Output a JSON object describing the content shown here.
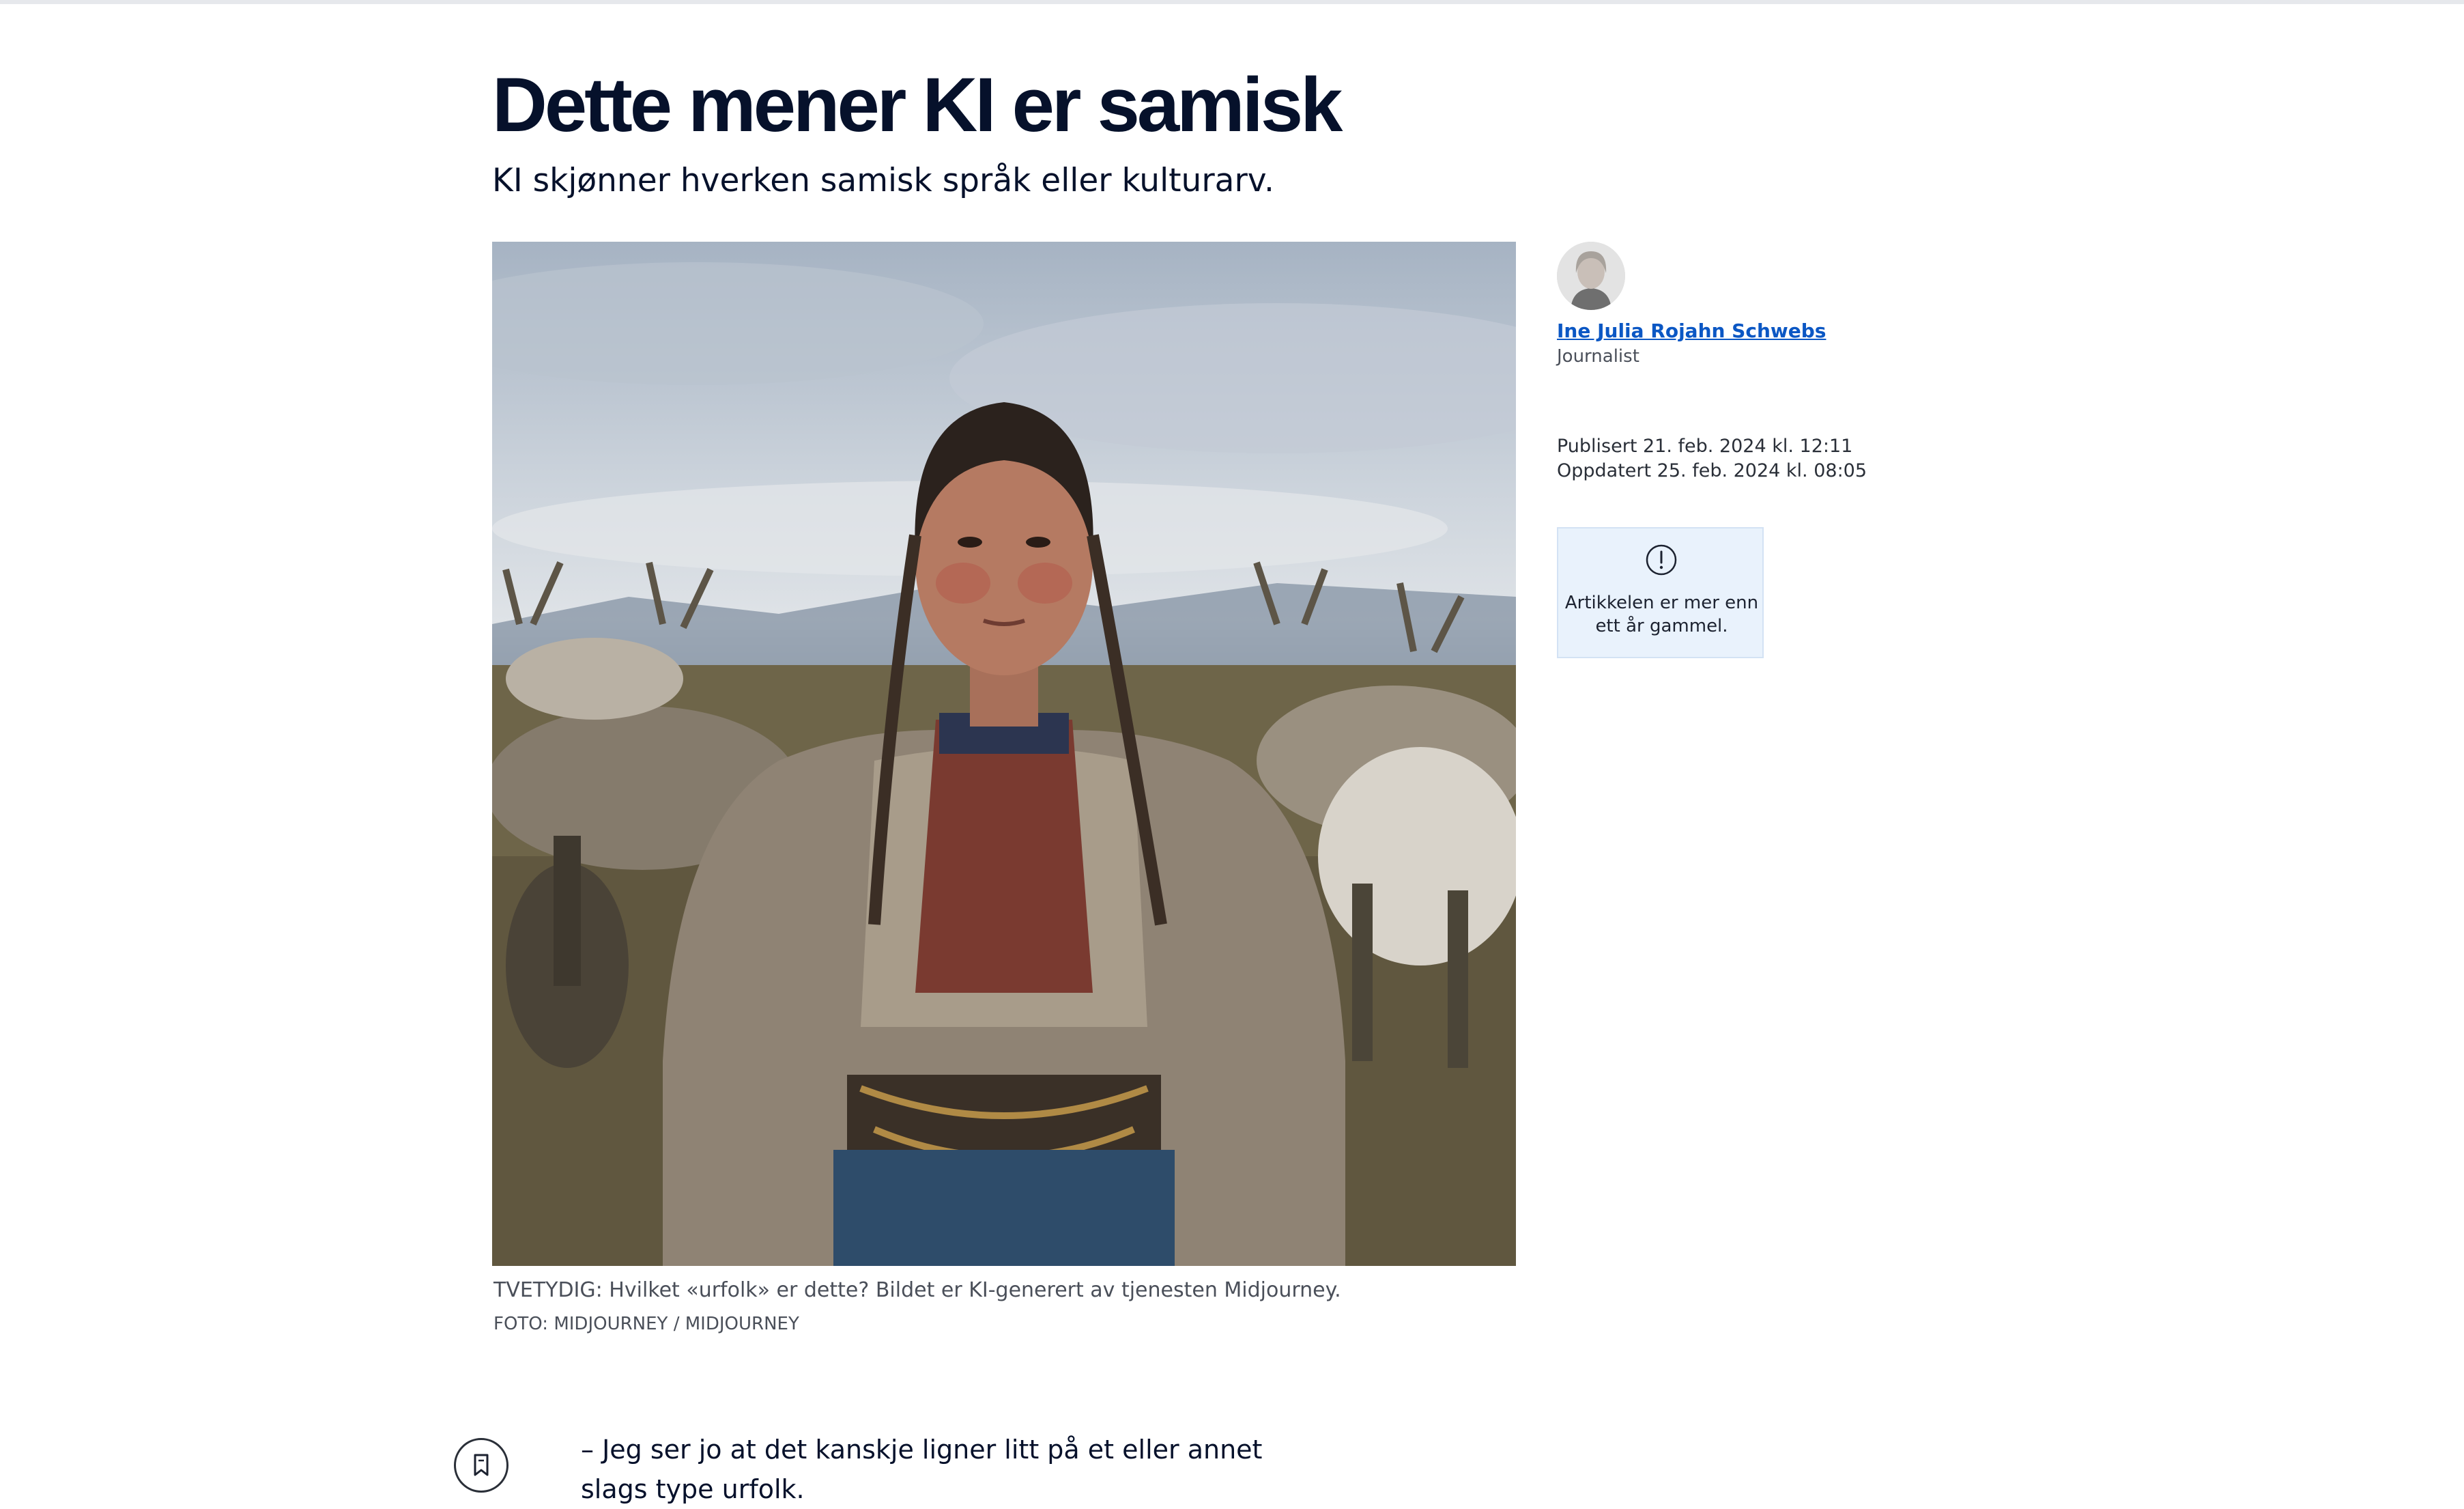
{
  "article": {
    "title": "Dette mener KI er samisk",
    "lead": "KI skjønner hverken samisk språk eller kulturarv.",
    "image_caption": "TVETYDIG: Hvilket «urfolk» er dette? Bildet er KI-generert av tjenesten Midjourney.",
    "image_credit": "FOTO: MIDJOURNEY / MIDJOURNEY",
    "body_first_paragraph": "– Jeg ser jo at det kanskje ligner litt på et eller annet slags type urfolk."
  },
  "author": {
    "name": "Ine Julia Rojahn Schwebs",
    "role": "Journalist"
  },
  "meta": {
    "published": "Publisert 21. feb. 2024 kl. 12:11",
    "updated": "Oppdatert 25. feb. 2024 kl. 08:05"
  },
  "notice": {
    "text": "Artikkelen er mer enn ett år gammel.",
    "icon": "exclamation-circle-icon"
  },
  "icons": {
    "bookmark": "bookmark-icon"
  },
  "colors": {
    "heading": "#06112b",
    "link": "#0b57c4",
    "notice_bg": "#e9f2fc"
  }
}
